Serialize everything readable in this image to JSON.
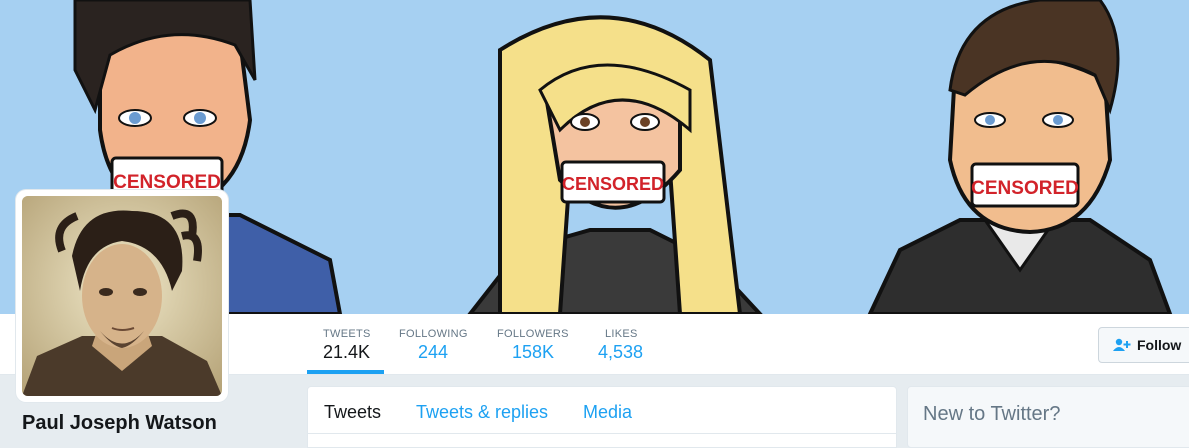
{
  "profile": {
    "name": "Paul Joseph Watson"
  },
  "banner": {
    "censor_labels": [
      "CENSORED",
      "CENSORED",
      "CENSORED"
    ]
  },
  "stats": [
    {
      "label": "TWEETS",
      "value": "21.4K"
    },
    {
      "label": "FOLLOWING",
      "value": "244"
    },
    {
      "label": "FOLLOWERS",
      "value": "158K"
    },
    {
      "label": "LIKES",
      "value": "4,538"
    }
  ],
  "follow_button": {
    "label": "Follow",
    "icon": "add-user-icon"
  },
  "timeline": {
    "tabs": [
      "Tweets",
      "Tweets & replies",
      "Media"
    ]
  },
  "sidebar": {
    "signup_title": "New to Twitter?"
  },
  "colors": {
    "accent": "#1da1f2",
    "banner_bg": "#a6d0f2",
    "page_bg": "#e6ecf0"
  }
}
